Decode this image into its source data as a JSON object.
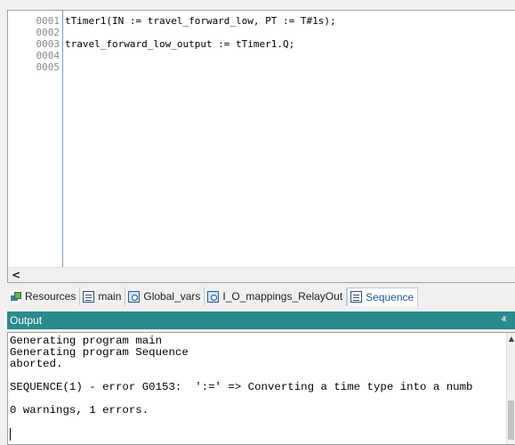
{
  "editor": {
    "line_numbers": [
      "0001",
      "0002",
      "0003",
      "0004",
      "0005"
    ],
    "lines": [
      "tTimer1(IN := travel_forward_low, PT := T#1s);",
      "",
      "travel_forward_low_output := tTimer1.Q;",
      "",
      ""
    ],
    "hscroll_left_glyph": "<"
  },
  "tabs": [
    {
      "label": "Resources",
      "icon": "resources-icon",
      "active": false
    },
    {
      "label": "main",
      "icon": "program-doc-icon",
      "active": false
    },
    {
      "label": "Global_vars",
      "icon": "variables-gear-icon",
      "active": false
    },
    {
      "label": "I_O_mappings_RelayOut",
      "icon": "io-mapping-gear-icon",
      "active": false
    },
    {
      "label": "Sequence",
      "icon": "program-doc-icon",
      "active": true
    }
  ],
  "output": {
    "title": "Output",
    "pin_glyph": "ⱏ",
    "lines": [
      "Generating program main",
      "Generating program Sequence",
      "aborted.",
      "",
      "SEQUENCE(1) - error G0153:  ':=' => Converting a time type into a numb",
      "",
      "0 warnings, 1 errors."
    ],
    "scroll_up_glyph": "▲"
  },
  "colors": {
    "output_header_bg": "#2b8a8c",
    "active_tab_text": "#1a5aa6"
  }
}
